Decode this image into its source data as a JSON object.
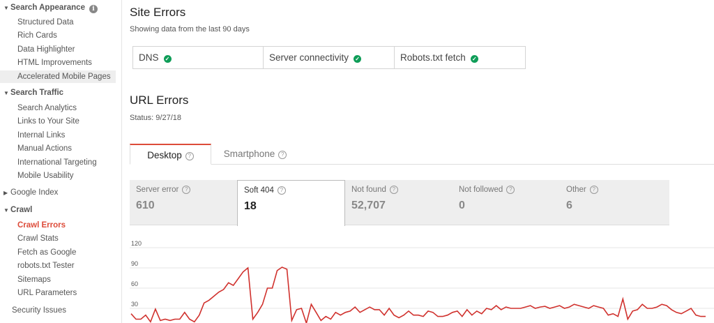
{
  "sidebar": {
    "search_appearance": {
      "label": "Search Appearance",
      "items": [
        "Structured Data",
        "Rich Cards",
        "Data Highlighter",
        "HTML Improvements",
        "Accelerated Mobile Pages"
      ]
    },
    "search_traffic": {
      "label": "Search Traffic",
      "items": [
        "Search Analytics",
        "Links to Your Site",
        "Internal Links",
        "Manual Actions",
        "International Targeting",
        "Mobile Usability"
      ]
    },
    "google_index": {
      "label": "Google Index"
    },
    "crawl": {
      "label": "Crawl",
      "items": [
        "Crawl Errors",
        "Crawl Stats",
        "Fetch as Google",
        "robots.txt Tester",
        "Sitemaps",
        "URL Parameters"
      ]
    },
    "security_issues": {
      "label": "Security Issues"
    }
  },
  "site_errors": {
    "title": "Site Errors",
    "subtitle": "Showing data from the last 90 days",
    "checks": [
      "DNS",
      "Server connectivity",
      "Robots.txt fetch"
    ]
  },
  "url_errors": {
    "title": "URL Errors",
    "status": "Status: 9/27/18",
    "tabs": [
      "Desktop",
      "Smartphone"
    ],
    "stats": [
      {
        "label": "Server error",
        "value": "610"
      },
      {
        "label": "Soft 404",
        "value": "18"
      },
      {
        "label": "Not found",
        "value": "52,707"
      },
      {
        "label": "Not followed",
        "value": "0"
      },
      {
        "label": "Other",
        "value": "6"
      }
    ]
  },
  "colors": {
    "accent": "#dd4b39",
    "ok": "#0f9d58",
    "line": "#d0312d"
  },
  "chart_data": {
    "type": "line",
    "y_ticks": [
      "120",
      "90",
      "60",
      "30"
    ],
    "ylim": [
      0,
      120
    ],
    "grid": true,
    "series": [
      {
        "values": [
          22,
          14,
          14,
          20,
          10,
          29,
          12,
          14,
          12,
          14,
          14,
          24,
          14,
          10,
          20,
          38,
          42,
          48,
          54,
          58,
          68,
          64,
          74,
          84,
          90,
          14,
          24,
          36,
          60,
          60,
          86,
          91,
          88,
          12,
          28,
          30,
          8,
          36,
          24,
          12,
          18,
          14,
          24,
          20,
          24,
          26,
          32,
          24,
          28,
          32,
          28,
          28,
          20,
          30,
          20,
          16,
          20,
          26,
          20,
          20,
          18,
          26,
          24,
          18,
          18,
          20,
          24,
          26,
          18,
          28,
          20,
          26,
          22,
          30,
          28,
          34,
          28,
          32,
          30,
          30,
          30,
          32,
          34,
          30,
          32,
          33,
          30,
          32,
          34,
          30,
          32,
          36,
          34,
          32,
          30,
          34,
          32,
          30,
          20,
          22,
          18,
          44,
          14,
          26,
          28,
          36,
          30,
          30,
          32,
          36,
          34,
          28,
          24,
          22,
          26,
          30,
          20,
          18,
          18
        ]
      }
    ]
  }
}
